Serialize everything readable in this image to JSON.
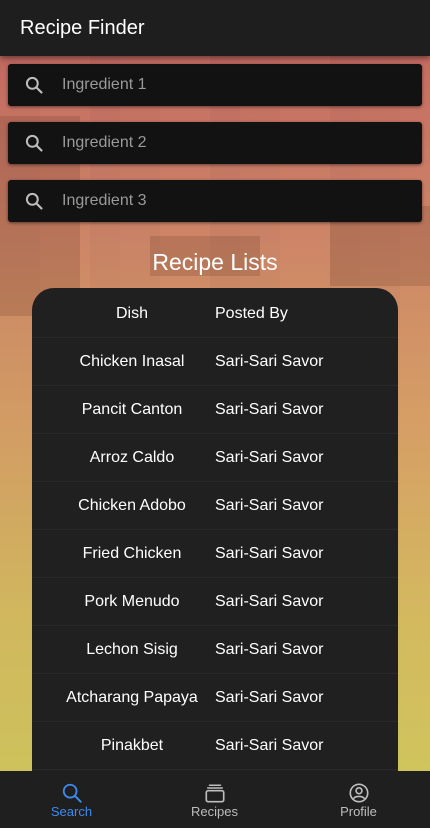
{
  "appbar": {
    "title": "Recipe Finder"
  },
  "search": {
    "fields": [
      {
        "placeholder": "Ingredient 1",
        "value": ""
      },
      {
        "placeholder": "Ingredient 2",
        "value": ""
      },
      {
        "placeholder": "Ingredient 3",
        "value": ""
      }
    ],
    "icon": "search-icon"
  },
  "recipes": {
    "heading": "Recipe Lists",
    "columns": [
      "Dish",
      "Posted By"
    ],
    "rows": [
      {
        "dish": "Chicken Inasal",
        "posted_by": "Sari-Sari Savor"
      },
      {
        "dish": "Pancit Canton",
        "posted_by": "Sari-Sari Savor"
      },
      {
        "dish": "Arroz Caldo",
        "posted_by": "Sari-Sari Savor"
      },
      {
        "dish": "Chicken Adobo",
        "posted_by": "Sari-Sari Savor"
      },
      {
        "dish": "Fried Chicken",
        "posted_by": "Sari-Sari Savor"
      },
      {
        "dish": "Pork Menudo",
        "posted_by": "Sari-Sari Savor"
      },
      {
        "dish": "Lechon Sisig",
        "posted_by": "Sari-Sari Savor"
      },
      {
        "dish": "Atcharang Papaya",
        "posted_by": "Sari-Sari Savor"
      },
      {
        "dish": "Pinakbet",
        "posted_by": "Sari-Sari Savor"
      }
    ]
  },
  "nav": {
    "items": [
      {
        "label": "Search",
        "icon": "search-icon",
        "active": true
      },
      {
        "label": "Recipes",
        "icon": "recipes-icon",
        "active": false
      },
      {
        "label": "Profile",
        "icon": "profile-icon",
        "active": false
      }
    ]
  },
  "colors": {
    "accent": "#3d8bf0",
    "surface": "#202020",
    "appbar": "#1e1e1e"
  }
}
